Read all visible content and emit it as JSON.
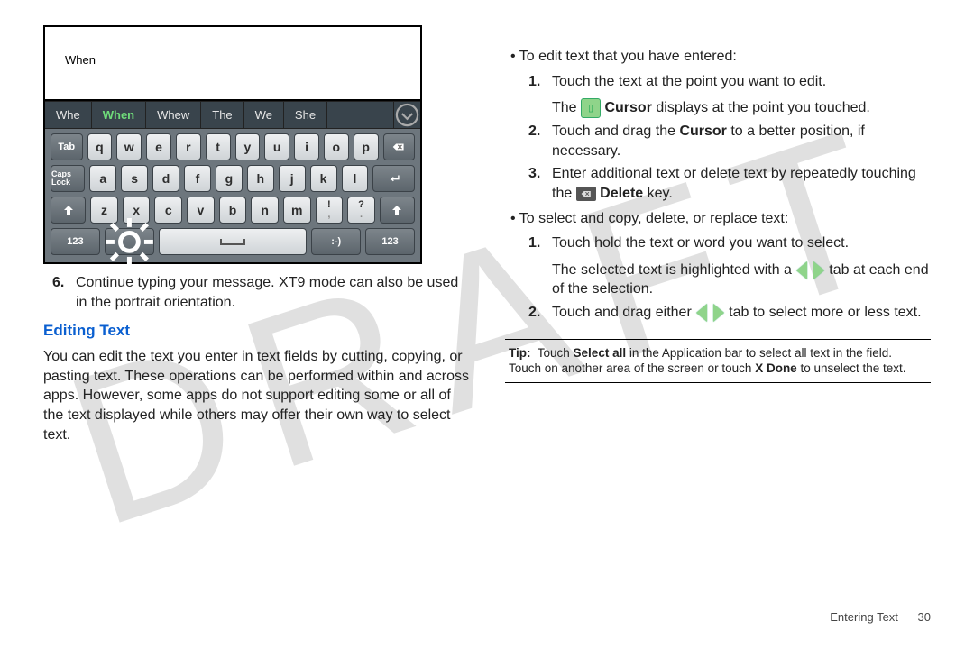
{
  "watermark": "DRAFT",
  "left": {
    "keyboard": {
      "typed": "When",
      "suggestions": [
        "Whe",
        "When",
        "Whew",
        "The",
        "We",
        "She"
      ],
      "active_suggestion": 1,
      "rows": {
        "r1": [
          "Tab",
          "q",
          "w",
          "e",
          "r",
          "t",
          "y",
          "u",
          "i",
          "o",
          "p",
          "bksp"
        ],
        "r2": [
          "Caps Lock",
          "a",
          "s",
          "d",
          "f",
          "g",
          "h",
          "j",
          "k",
          "l",
          "enter"
        ],
        "r3": [
          "shift",
          "z",
          "x",
          "c",
          "v",
          "b",
          "n",
          "m",
          "!",
          ",",
          "?",
          ".",
          "shift"
        ],
        "r4": [
          "123",
          "gear",
          "space",
          ":-)",
          "123"
        ]
      }
    },
    "step6_num": "6.",
    "step6": "Continue typing your message. XT9 mode can also be used in the portrait orientation.",
    "heading": "Editing Text",
    "para": "You can edit the text you enter in text fields by cutting, copying, or pasting text. These operations can be performed within and across apps. However, some apps do not support editing some or all of the text displayed while others may offer their own way to select text."
  },
  "right": {
    "bullet_edit": "To edit text that you have entered:",
    "n1": "1.",
    "e1a": "Touch the text at the point you want to edit.",
    "e1b_pre": "The ",
    "e1b_bold": "Cursor",
    "e1b_post": " displays at the point you touched.",
    "n2": "2.",
    "e2a": "Touch and drag the ",
    "e2b_bold": "Cursor",
    "e2c": " to a better position, if necessary.",
    "n3": "3.",
    "e3a": "Enter additional text or delete text by repeatedly touching the ",
    "e3b_bold": "Delete",
    "e3c": " key.",
    "bullet_select": "To select and copy, delete, or replace text:",
    "s1n": "1.",
    "s1a": "Touch hold the text or word you want to select.",
    "s1b": "The selected text is highlighted with a ",
    "s1c": " tab at each end of the selection.",
    "s2n": "2.",
    "s2a": "Touch and drag either ",
    "s2b": " tab to select more or less text.",
    "tip_label": "Tip:",
    "tip_body1": "Touch ",
    "tip_bold1": "Select all",
    "tip_body2": " in the Application bar to select all text in the field. Touch on another area of the screen or touch ",
    "tip_bold2": "X Done",
    "tip_body3": " to unselect the text."
  },
  "footer": {
    "section": "Entering Text",
    "page": "30"
  }
}
